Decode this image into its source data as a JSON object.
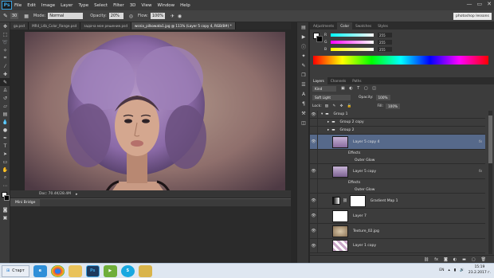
{
  "menubar": {
    "app_badge": "Ps",
    "items": [
      "File",
      "Edit",
      "Image",
      "Layer",
      "Type",
      "Select",
      "Filter",
      "3D",
      "View",
      "Window",
      "Help"
    ],
    "window_controls": [
      "—",
      "▭",
      "✕"
    ]
  },
  "options_bar": {
    "brush_size": "30",
    "mode_label": "Mode:",
    "mode_value": "Normal",
    "opacity_label": "Opacity:",
    "opacity_value": "20%",
    "flow_label": "Flow:",
    "flow_value": "100%",
    "workspace": "photoshop lessons"
  },
  "doc_tabs": [
    "ga.psd",
    "MR4_L4b_Color_Range.psd",
    "задача мое решение.psd",
    "wsnia_pilkowata1.jpg @ 111% (Layer 5 copy 4, RGB/8#) *"
  ],
  "doc_tab_active_index": 3,
  "status": {
    "doc_info": "Doc: 70.4K/28.4M"
  },
  "mini_bridge": {
    "title": "Mini Bridge"
  },
  "color_panel": {
    "tabs": [
      "Adjustments",
      "Color",
      "Swatches",
      "Styles"
    ],
    "active_tab": "Color",
    "channels": [
      {
        "label": "R",
        "value": "255"
      },
      {
        "label": "G",
        "value": "255"
      },
      {
        "label": "B",
        "value": "255"
      }
    ]
  },
  "layers_panel": {
    "tabs": [
      "Layers",
      "Channels",
      "Paths"
    ],
    "active_tab": "Layers",
    "filter_kind": "Kind",
    "blend_mode": "Soft Light",
    "opacity_label": "Opacity:",
    "opacity_value": "100%",
    "lock_label": "Lock:",
    "fill_label": "Fill:",
    "fill_value": "100%",
    "layers": [
      {
        "name": "Group 1",
        "kind": "group"
      },
      {
        "name": "Group 2 copy",
        "kind": "group"
      },
      {
        "name": "Group 2",
        "kind": "group"
      },
      {
        "name": "Layer 5 copy 4",
        "kind": "layer",
        "selected": true,
        "fx": "fx"
      },
      {
        "name": "Effects",
        "kind": "effect"
      },
      {
        "name": "Outer Glow",
        "kind": "effect"
      },
      {
        "name": "Layer 5 copy",
        "kind": "layer",
        "fx": "fx"
      },
      {
        "name": "Effects",
        "kind": "effect"
      },
      {
        "name": "Outer Glow",
        "kind": "effect"
      },
      {
        "name": "Gradient Map 1",
        "kind": "adjustment"
      },
      {
        "name": "Layer 7",
        "kind": "layer"
      },
      {
        "name": "Texture_02.jpg",
        "kind": "layer"
      },
      {
        "name": "Layer 1 copy",
        "kind": "layer"
      }
    ]
  },
  "taskbar": {
    "start_label": "Старт",
    "lang": "EN",
    "time": "15:19",
    "date": "23.2.2017 г."
  },
  "colors": {
    "selection": "#56698a",
    "accent_ps": "#3ba2e0"
  }
}
